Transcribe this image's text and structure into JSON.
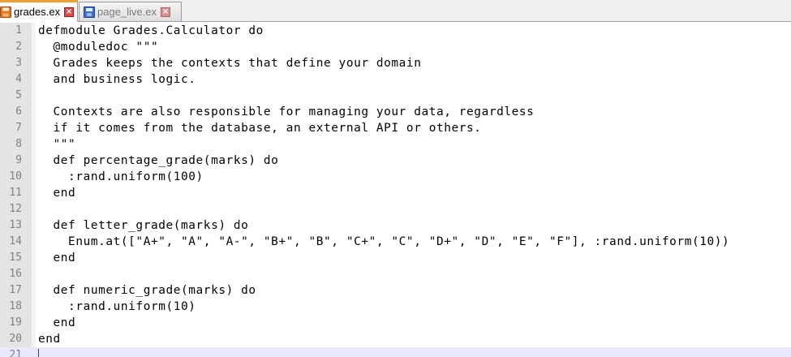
{
  "tabs": [
    {
      "label": "grades.ex",
      "active": true,
      "icon": "disk-orange-icon"
    },
    {
      "label": "page_live.ex",
      "active": false,
      "icon": "disk-blue-icon"
    }
  ],
  "editor": {
    "current_line": 21,
    "lines": [
      {
        "number": "1",
        "text": "defmodule Grades.Calculator do"
      },
      {
        "number": "2",
        "text": "  @moduledoc \"\"\""
      },
      {
        "number": "3",
        "text": "  Grades keeps the contexts that define your domain"
      },
      {
        "number": "4",
        "text": "  and business logic."
      },
      {
        "number": "5",
        "text": ""
      },
      {
        "number": "6",
        "text": "  Contexts are also responsible for managing your data, regardless"
      },
      {
        "number": "7",
        "text": "  if it comes from the database, an external API or others."
      },
      {
        "number": "8",
        "text": "  \"\"\""
      },
      {
        "number": "9",
        "text": "  def percentage_grade(marks) do"
      },
      {
        "number": "10",
        "text": "    :rand.uniform(100)"
      },
      {
        "number": "11",
        "text": "  end"
      },
      {
        "number": "12",
        "text": ""
      },
      {
        "number": "13",
        "text": "  def letter_grade(marks) do"
      },
      {
        "number": "14",
        "text": "    Enum.at([\"A+\", \"A\", \"A-\", \"B+\", \"B\", \"C+\", \"C\", \"D+\", \"D\", \"E\", \"F\"], :rand.uniform(10))"
      },
      {
        "number": "15",
        "text": "  end"
      },
      {
        "number": "16",
        "text": ""
      },
      {
        "number": "17",
        "text": "  def numeric_grade(marks) do"
      },
      {
        "number": "18",
        "text": "    :rand.uniform(10)"
      },
      {
        "number": "19",
        "text": "  end"
      },
      {
        "number": "20",
        "text": "end"
      },
      {
        "number": "21",
        "text": ""
      }
    ]
  },
  "colors": {
    "active_tab_accent": "#f0a030",
    "current_line_bg": "#e8e8ff",
    "caret": "#8000ff",
    "line_number": "#808080"
  }
}
